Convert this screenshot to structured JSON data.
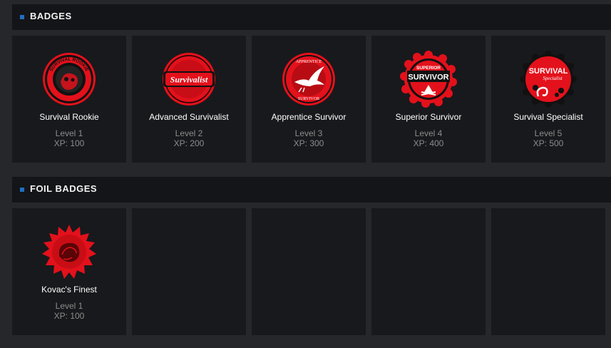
{
  "badges_section": {
    "title": "BADGES",
    "items": [
      {
        "name": "Survival Rookie",
        "level": "Level 1",
        "xp": "XP: 100",
        "icon": "survival-rookie-badge-icon"
      },
      {
        "name": "Advanced Survivalist",
        "level": "Level 2",
        "xp": "XP: 200",
        "icon": "advanced-survivalist-badge-icon"
      },
      {
        "name": "Apprentice Survivor",
        "level": "Level 3",
        "xp": "XP: 300",
        "icon": "apprentice-survivor-badge-icon"
      },
      {
        "name": "Superior Survivor",
        "level": "Level 4",
        "xp": "XP: 400",
        "icon": "superior-survivor-badge-icon"
      },
      {
        "name": "Survival Specialist",
        "level": "Level 5",
        "xp": "XP: 500",
        "icon": "survival-specialist-badge-icon"
      }
    ]
  },
  "foil_section": {
    "title": "FOIL BADGES",
    "items": [
      {
        "name": "Kovac's Finest",
        "level": "Level 1",
        "xp": "XP: 100",
        "icon": "kovacs-finest-foil-badge-icon"
      }
    ]
  },
  "badge_art": {
    "rookie_ring_text": "SURVIVAL ROOKIE",
    "survivalist_text": "Survivalist",
    "apprentice_top": "APPRENTICE",
    "apprentice_bottom": "SURVIVOR",
    "superior_top": "SUPERIOR",
    "superior_main": "SURVIVOR",
    "specialist_main": "SURVIVAL",
    "specialist_sub": "Specialist"
  },
  "colors": {
    "accent": "#1f6fc4",
    "badge_red": "#e3111b",
    "badge_dark": "#1a0000"
  }
}
